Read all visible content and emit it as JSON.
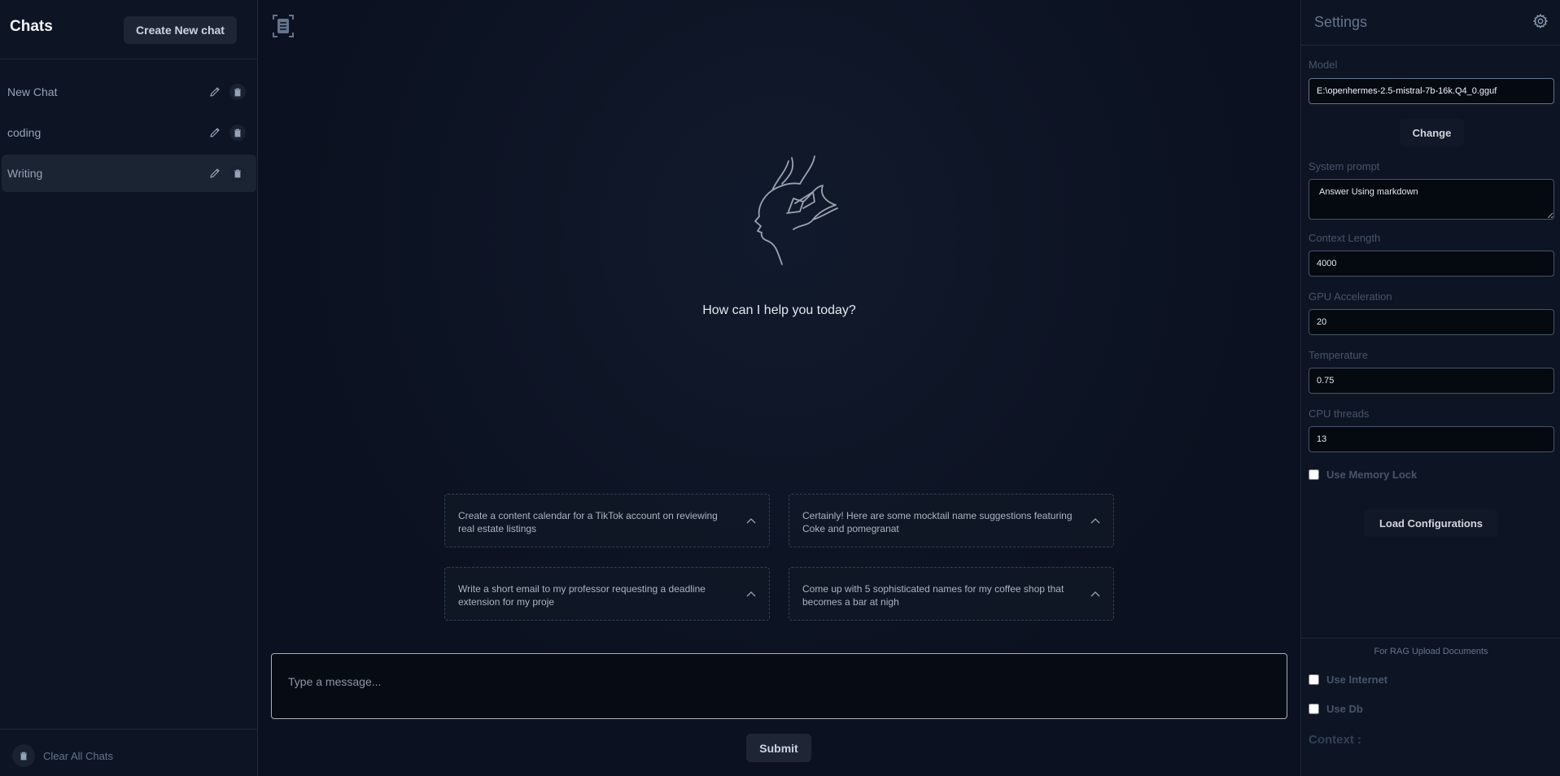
{
  "sidebar": {
    "title": "Chats",
    "new_chat_label": "Create New chat",
    "items": [
      {
        "label": "New Chat",
        "active": false
      },
      {
        "label": "coding",
        "active": false
      },
      {
        "label": "Writing",
        "active": true
      }
    ],
    "clear_label": "Clear All Chats"
  },
  "main": {
    "greeting": "How can I help you today?",
    "suggestions": [
      "Create a content calendar for a TikTok account on reviewing real estate listings",
      "Certainly! Here are some mocktail name suggestions featuring Coke and pomegranat",
      "Write a short email to my professor requesting a deadline extension for my proje",
      "Come up with 5 sophisticated names for my coffee shop that becomes a bar at nigh"
    ],
    "composer_placeholder": "Type a message...",
    "submit_label": "Submit"
  },
  "settings": {
    "title": "Settings",
    "model_label": "Model",
    "model_value": "E:\\openhermes-2.5-mistral-7b-16k.Q4_0.gguf",
    "change_label": "Change",
    "system_prompt_label": "System prompt",
    "system_prompt_value": "Answer Using markdown",
    "context_length_label": "Context Length",
    "context_length_value": "4000",
    "gpu_label": "GPU Acceleration",
    "gpu_value": "20",
    "temperature_label": "Temperature",
    "temperature_value": "0.75",
    "cpu_label": "CPU threads",
    "cpu_value": "13",
    "memory_lock_label": "Use Memory Lock",
    "load_label": "Load Configurations",
    "rag_title": "For RAG Upload Documents",
    "use_internet_label": "Use Internet",
    "use_db_label": "Use Db",
    "context_label": "Context :"
  },
  "colors": {
    "background": "#0b1120",
    "panel": "#0d1424",
    "button": "#1e2636",
    "border": "#1e293b"
  },
  "icons": [
    "edit-icon",
    "trash-icon",
    "gear-icon",
    "document-scan-icon",
    "chevron-up-icon",
    "face-sketch-logo"
  ]
}
